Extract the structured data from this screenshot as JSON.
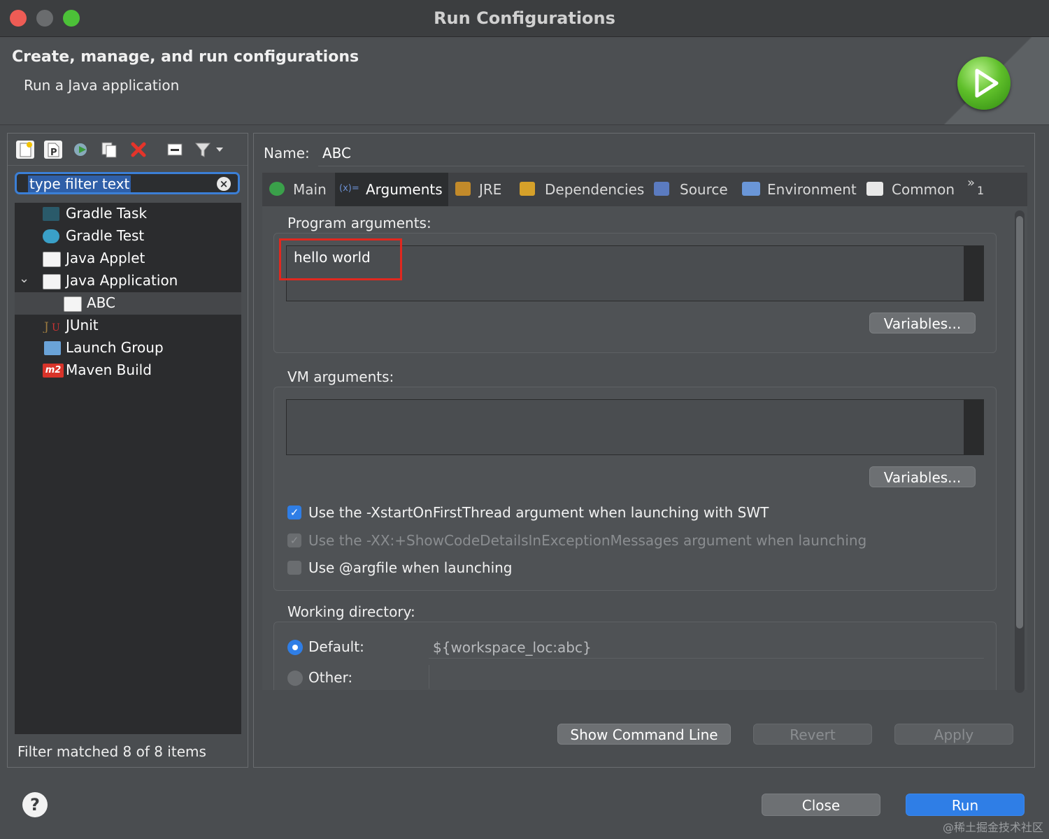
{
  "window": {
    "title": "Run Configurations"
  },
  "header": {
    "title": "Create, manage, and run configurations",
    "subtitle": "Run a Java application",
    "badge_icon": "run-play-icon"
  },
  "left": {
    "toolbar_icons": [
      "new-config-icon",
      "new-prototype-icon",
      "export-icon",
      "duplicate-icon",
      "delete-icon",
      "collapse-all-icon",
      "filter-icon",
      "filter-dropdown-icon"
    ],
    "filter_placeholder": "type filter text",
    "tree": [
      {
        "label": "Gradle Task",
        "icon": "gradle-icon"
      },
      {
        "label": "Gradle Test",
        "icon": "gradle-elephant-icon"
      },
      {
        "label": "Java Applet",
        "icon": "java-applet-icon"
      },
      {
        "label": "Java Application",
        "icon": "java-application-icon",
        "expanded": true
      },
      {
        "label": "ABC",
        "icon": "java-application-icon",
        "selected": true
      },
      {
        "label": "JUnit",
        "icon": "junit-icon"
      },
      {
        "label": "Launch Group",
        "icon": "launch-group-icon"
      },
      {
        "label": "Maven Build",
        "icon": "maven-icon"
      }
    ],
    "status": "Filter matched 8 of 8 items"
  },
  "right": {
    "name_label": "Name:",
    "name_value": "ABC",
    "tabs": [
      {
        "label": "Main",
        "icon": "main-class-icon"
      },
      {
        "label": "Arguments",
        "icon": "arguments-icon",
        "active": true
      },
      {
        "label": "JRE",
        "icon": "jre-icon"
      },
      {
        "label": "Dependencies",
        "icon": "dependencies-icon"
      },
      {
        "label": "Source",
        "icon": "source-icon"
      },
      {
        "label": "Environment",
        "icon": "environment-icon"
      },
      {
        "label": "Common",
        "icon": "common-icon"
      },
      {
        "label": "1",
        "icon": "overflow-chevron-icon"
      }
    ],
    "program_args_label": "Program arguments:",
    "program_args_value": "hello world",
    "variables_label": "Variables...",
    "vm_args_label": "VM arguments:",
    "vm_args_value": "",
    "options": [
      {
        "label": "Use the -XstartOnFirstThread argument when launching with SWT",
        "checked": true,
        "disabled": false
      },
      {
        "label": "Use the -XX:+ShowCodeDetailsInExceptionMessages argument when launching",
        "checked": true,
        "disabled": true
      },
      {
        "label": "Use @argfile when launching",
        "checked": false,
        "disabled": false
      }
    ],
    "working_dir_label": "Working directory:",
    "default_label": "Default:",
    "default_value": "${workspace_loc:abc}",
    "other_label": "Other:",
    "show_command_line": "Show Command Line",
    "revert": "Revert",
    "apply": "Apply"
  },
  "footer": {
    "close": "Close",
    "run": "Run",
    "watermark": "@稀土掘金技术社区"
  },
  "colors": {
    "accent": "#2f7ee6",
    "highlight_box": "#e0281f"
  }
}
